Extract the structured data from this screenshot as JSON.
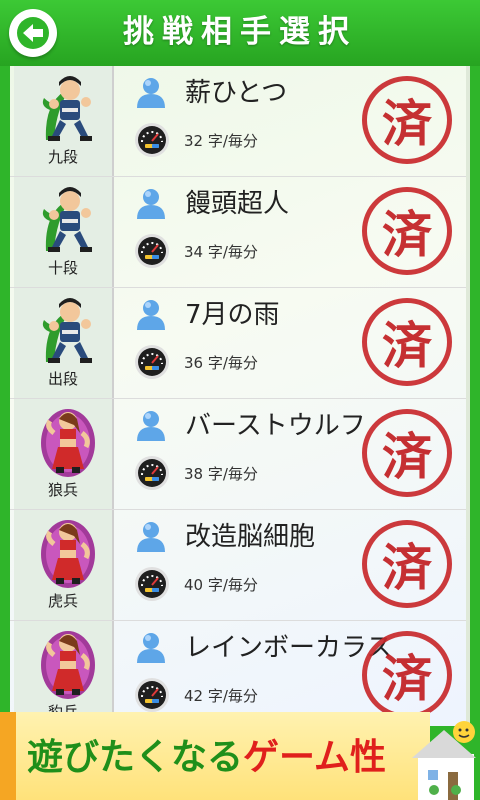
{
  "header": {
    "title": "挑戦相手選択"
  },
  "opponents": [
    {
      "rank": "九段",
      "name": "薪ひとつ",
      "speed": "32 字/毎分",
      "status": "済",
      "avatar": "ninja-man"
    },
    {
      "rank": "十段",
      "name": "饅頭超人",
      "speed": "34 字/毎分",
      "status": "済",
      "avatar": "ninja-man"
    },
    {
      "rank": "出段",
      "name": "7月の雨",
      "speed": "36 字/毎分",
      "status": "済",
      "avatar": "ninja-man"
    },
    {
      "rank": "狼兵",
      "name": "バーストウルフ",
      "speed": "38 字/毎分",
      "status": "済",
      "avatar": "kunoichi"
    },
    {
      "rank": "虎兵",
      "name": "改造脳細胞",
      "speed": "40 字/毎分",
      "status": "済",
      "avatar": "kunoichi"
    },
    {
      "rank": "豹兵",
      "name": "レインボーカラス",
      "speed": "42 字/毎分",
      "status": "済",
      "avatar": "kunoichi"
    }
  ],
  "banner": {
    "text_green": "遊びたくなる",
    "text_red": "ゲーム",
    "text_tail": "性"
  },
  "colors": {
    "header_green": "#2fb52a",
    "stamp_red": "#c8282b",
    "banner_green": "#1f8f1a",
    "banner_red": "#e0201c"
  }
}
